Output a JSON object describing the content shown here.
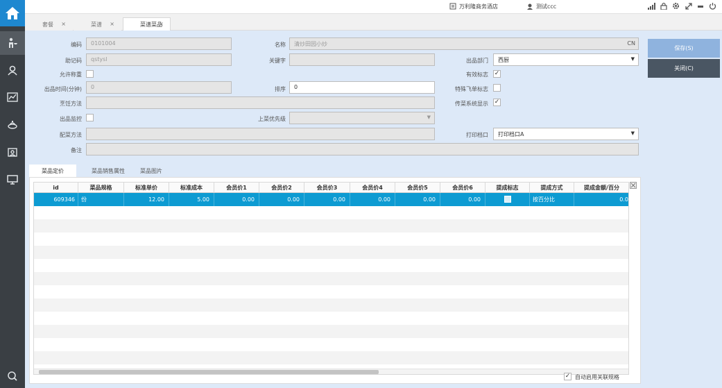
{
  "topbar": {
    "hotel_name": "万利隆商务酒店",
    "user_name": "测试ccc"
  },
  "tabs": [
    {
      "label": "套餐",
      "close": "×"
    },
    {
      "label": "菜谱",
      "close": "×"
    },
    {
      "label": "菜谱菜品",
      "close": "×"
    }
  ],
  "form": {
    "code_label": "编码",
    "code_value": "0101004",
    "name_label": "名称",
    "name_value": "清炒田园小炒",
    "name_suffix": "CN",
    "mnemonic_label": "助记码",
    "mnemonic_value": "qstysl",
    "keyword_label": "关键字",
    "keyword_value": "",
    "dept_label": "出品部门",
    "dept_value": "西厨",
    "allow_count_label": "允许称重",
    "valid_label": "有效标志",
    "valid_checked": "✓",
    "time_label": "出品时间(分钟)",
    "time_value": "0",
    "sort_label": "排序",
    "sort_value": "0",
    "special_label": "特殊飞单标志",
    "cook_label": "烹饪方法",
    "cook_value": "",
    "kds_label": "传菜系统显示",
    "kds_checked": "✓",
    "monitor_label": "出品监控",
    "priority_label": "上菜优先级",
    "priority_value": "",
    "garnish_label": "配菜方法",
    "garnish_value": "",
    "port_label": "打印档口",
    "port_value": "打印档口A",
    "remark_label": "备注",
    "remark_value": ""
  },
  "buttons": {
    "save": "保存(S)",
    "close": "关闭(C)"
  },
  "subtabs": [
    "菜品定价",
    "菜品销售属性",
    "菜品图片"
  ],
  "table": {
    "columns": [
      "id",
      "菜品规格",
      "标准单价",
      "标准成本",
      "会员价1",
      "会员价2",
      "会员价3",
      "会员价4",
      "会员价5",
      "会员价6",
      "提成标志",
      "提成方式",
      "提成金额/百分"
    ],
    "rows": [
      [
        "609346",
        "份",
        "12.00",
        "5.00",
        "0.00",
        "0.00",
        "0.00",
        "0.00",
        "0.00",
        "0.00",
        "",
        "按百分比",
        "0.0"
      ]
    ]
  },
  "footer": {
    "auto_enable_label": "自动启用关联规格",
    "auto_enable_checked": "✓"
  },
  "colors": {
    "accent": "#0d9bd2",
    "sidebar": "#3a3f44",
    "home": "#1e88d0",
    "save_btn": "#8fb3de",
    "close_btn": "#4a5663"
  },
  "icons": [
    "home-icon",
    "waiter-icon",
    "user-icon",
    "chart-icon",
    "dish-icon",
    "inventory-icon",
    "monitor-icon",
    "logout-icon",
    "store-icon",
    "lock-icon",
    "signal-icon",
    "gear-icon",
    "expand-icon",
    "minimize-icon",
    "power-icon",
    "settings-small-icon"
  ]
}
